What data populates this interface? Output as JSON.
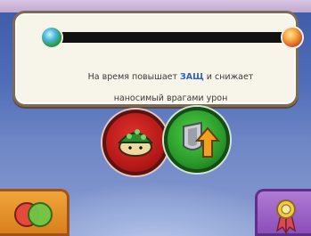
{
  "dialog": {
    "line1_a": "На время повышает ",
    "line1_highlight": "ЗАЩ",
    "line1_b": " и снижает",
    "line2": "наносимый врагами урон"
  },
  "icons": {
    "progress_left": "green-orb-icon",
    "progress_right": "fire-orb-icon",
    "skill_left": "turtle-shell-icon",
    "skill_right": "shield-up-arrow-icon",
    "menu_left": "two-circles-icon",
    "menu_right": "medal-ribbon-icon"
  },
  "colors": {
    "highlight": "#2f63c8",
    "skill_left": "#c0211f",
    "skill_right": "#2fa02f",
    "menu_left": "#e8922a",
    "menu_right": "#9c63c8"
  }
}
